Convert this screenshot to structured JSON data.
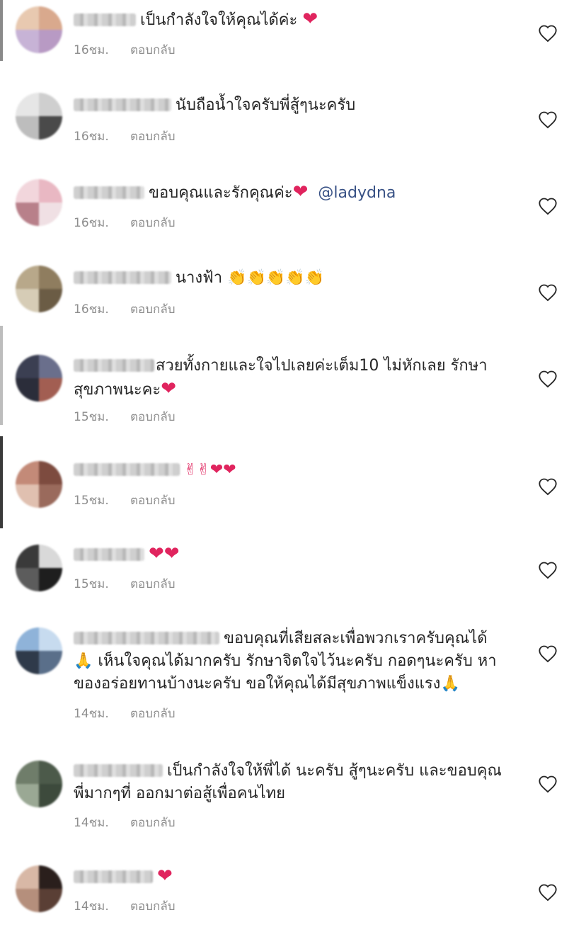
{
  "comments": [
    {
      "text": "เป็นกำลังใจให้คุณได้ค่ะ ",
      "emoji": "❤",
      "time": "16ชม.",
      "reply": "ตอบกลับ",
      "avatar_colors": [
        "#e8c9b0",
        "#d9a98d",
        "#c7b3d6",
        "#b89ac4"
      ]
    },
    {
      "text": "นับถือน้ำใจครับพี่สู้ๆนะครับ",
      "time": "16ชม.",
      "reply": "ตอบกลับ",
      "avatar_colors": [
        "#e6e6e6",
        "#cfcfcf",
        "#bdbdbd",
        "#4a4a4a"
      ]
    },
    {
      "text": "ขอบคุณและรักคุณค่ะ",
      "emoji": "❤",
      "mention": "@ladydna",
      "time": "16ชม.",
      "reply": "ตอบกลับ",
      "avatar_colors": [
        "#f2d6dc",
        "#e9b8c3",
        "#b8808a",
        "#f0e0e4"
      ]
    },
    {
      "text": "นางฟ้า ",
      "emoji": "👏👏👏👏👏",
      "time": "16ชม.",
      "reply": "ตอบกลับ",
      "avatar_colors": [
        "#b8a88a",
        "#8f7d5f",
        "#d6ccb6",
        "#6b5c45"
      ]
    },
    {
      "text": "สวยทั้งกายและใจไปเลยค่ะเต็ม10 ไม่หักเลย รักษาสุขภาพนะคะ",
      "emoji": "❤",
      "time": "15ชม.",
      "reply": "ตอบกลับ",
      "avatar_colors": [
        "#3b3f52",
        "#6a6f8c",
        "#2b2d3a",
        "#a25e52"
      ]
    },
    {
      "text": "",
      "emoji": "✌✌❤❤",
      "time": "15ชม.",
      "reply": "ตอบกลับ",
      "avatar_colors": [
        "#c38a78",
        "#7d4b3f",
        "#e0c0b0",
        "#9a6a5c"
      ]
    },
    {
      "text": "",
      "emoji": "❤❤",
      "time": "15ชม.",
      "reply": "ตอบกลับ",
      "avatar_colors": [
        "#3a3a3a",
        "#d9d9d9",
        "#5c5c5c",
        "#1e1e1e"
      ]
    },
    {
      "text": "ขอบคุณที่เสียสละเพื่อพวกเราครับคุณได้ ",
      "text2": " เห็นใจคุณได้มากครับ รักษาจิตใจไว้นะครับ กอดๆนะครับ หาของอร่อยทานบ้างนะครับ ขอให้คุณได้มีสุขภาพแข็งแรง",
      "emoji": "🙏",
      "emoji2": "🙏",
      "time": "14ชม.",
      "reply": "ตอบกลับ",
      "avatar_colors": [
        "#8fb3d9",
        "#c7dbef",
        "#2f3a4a",
        "#5a6f8a"
      ]
    },
    {
      "text": "เป็นกำลังใจให้พี่ได้ นะครับ สู้ๆนะครับ และขอบคุณพี่มากๆที่ ออกมาต่อสู้เพื่อคนไทย",
      "time": "14ชม.",
      "reply": "ตอบกลับ",
      "avatar_colors": [
        "#6f7d6a",
        "#4c5a4a",
        "#9aa894",
        "#3d4a3c"
      ]
    },
    {
      "text": "",
      "emoji": "❤",
      "time": "14ชม.",
      "reply": "ตอบกลับ",
      "avatar_colors": [
        "#d8b8a6",
        "#2a1f1c",
        "#b58f7c",
        "#5a3f35"
      ]
    }
  ]
}
